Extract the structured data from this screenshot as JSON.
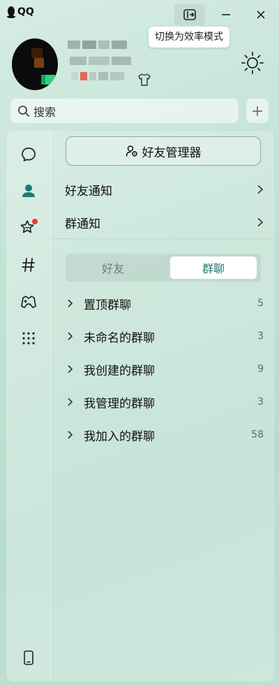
{
  "app": {
    "name": "QQ"
  },
  "window": {
    "mode_tooltip": "切换为效率模式"
  },
  "search": {
    "placeholder": "搜索"
  },
  "contacts": {
    "friend_manager_label": "好友管理器",
    "friend_notice_label": "好友通知",
    "group_notice_label": "群通知",
    "tabs": [
      {
        "label": "好友",
        "active": false
      },
      {
        "label": "群聊",
        "active": true
      }
    ],
    "groups": [
      {
        "name": "置顶群聊",
        "count": "5"
      },
      {
        "name": "未命名的群聊",
        "count": "3"
      },
      {
        "name": "我创建的群聊",
        "count": "9"
      },
      {
        "name": "我管理的群聊",
        "count": "3"
      },
      {
        "name": "我加入的群聊",
        "count": "58"
      }
    ]
  },
  "sidebar": {
    "items": [
      {
        "icon": "message-icon",
        "active": false
      },
      {
        "icon": "contacts-icon",
        "active": true
      },
      {
        "icon": "star-icon",
        "active": false,
        "badge": true
      },
      {
        "icon": "channel-hash-icon",
        "active": false
      },
      {
        "icon": "game-controller-icon",
        "active": false
      },
      {
        "icon": "apps-grid-icon",
        "active": false
      }
    ],
    "bottom_icon": "phone-icon"
  },
  "colors": {
    "accent": "#1f7a6e",
    "badge": "#f03a2e"
  }
}
